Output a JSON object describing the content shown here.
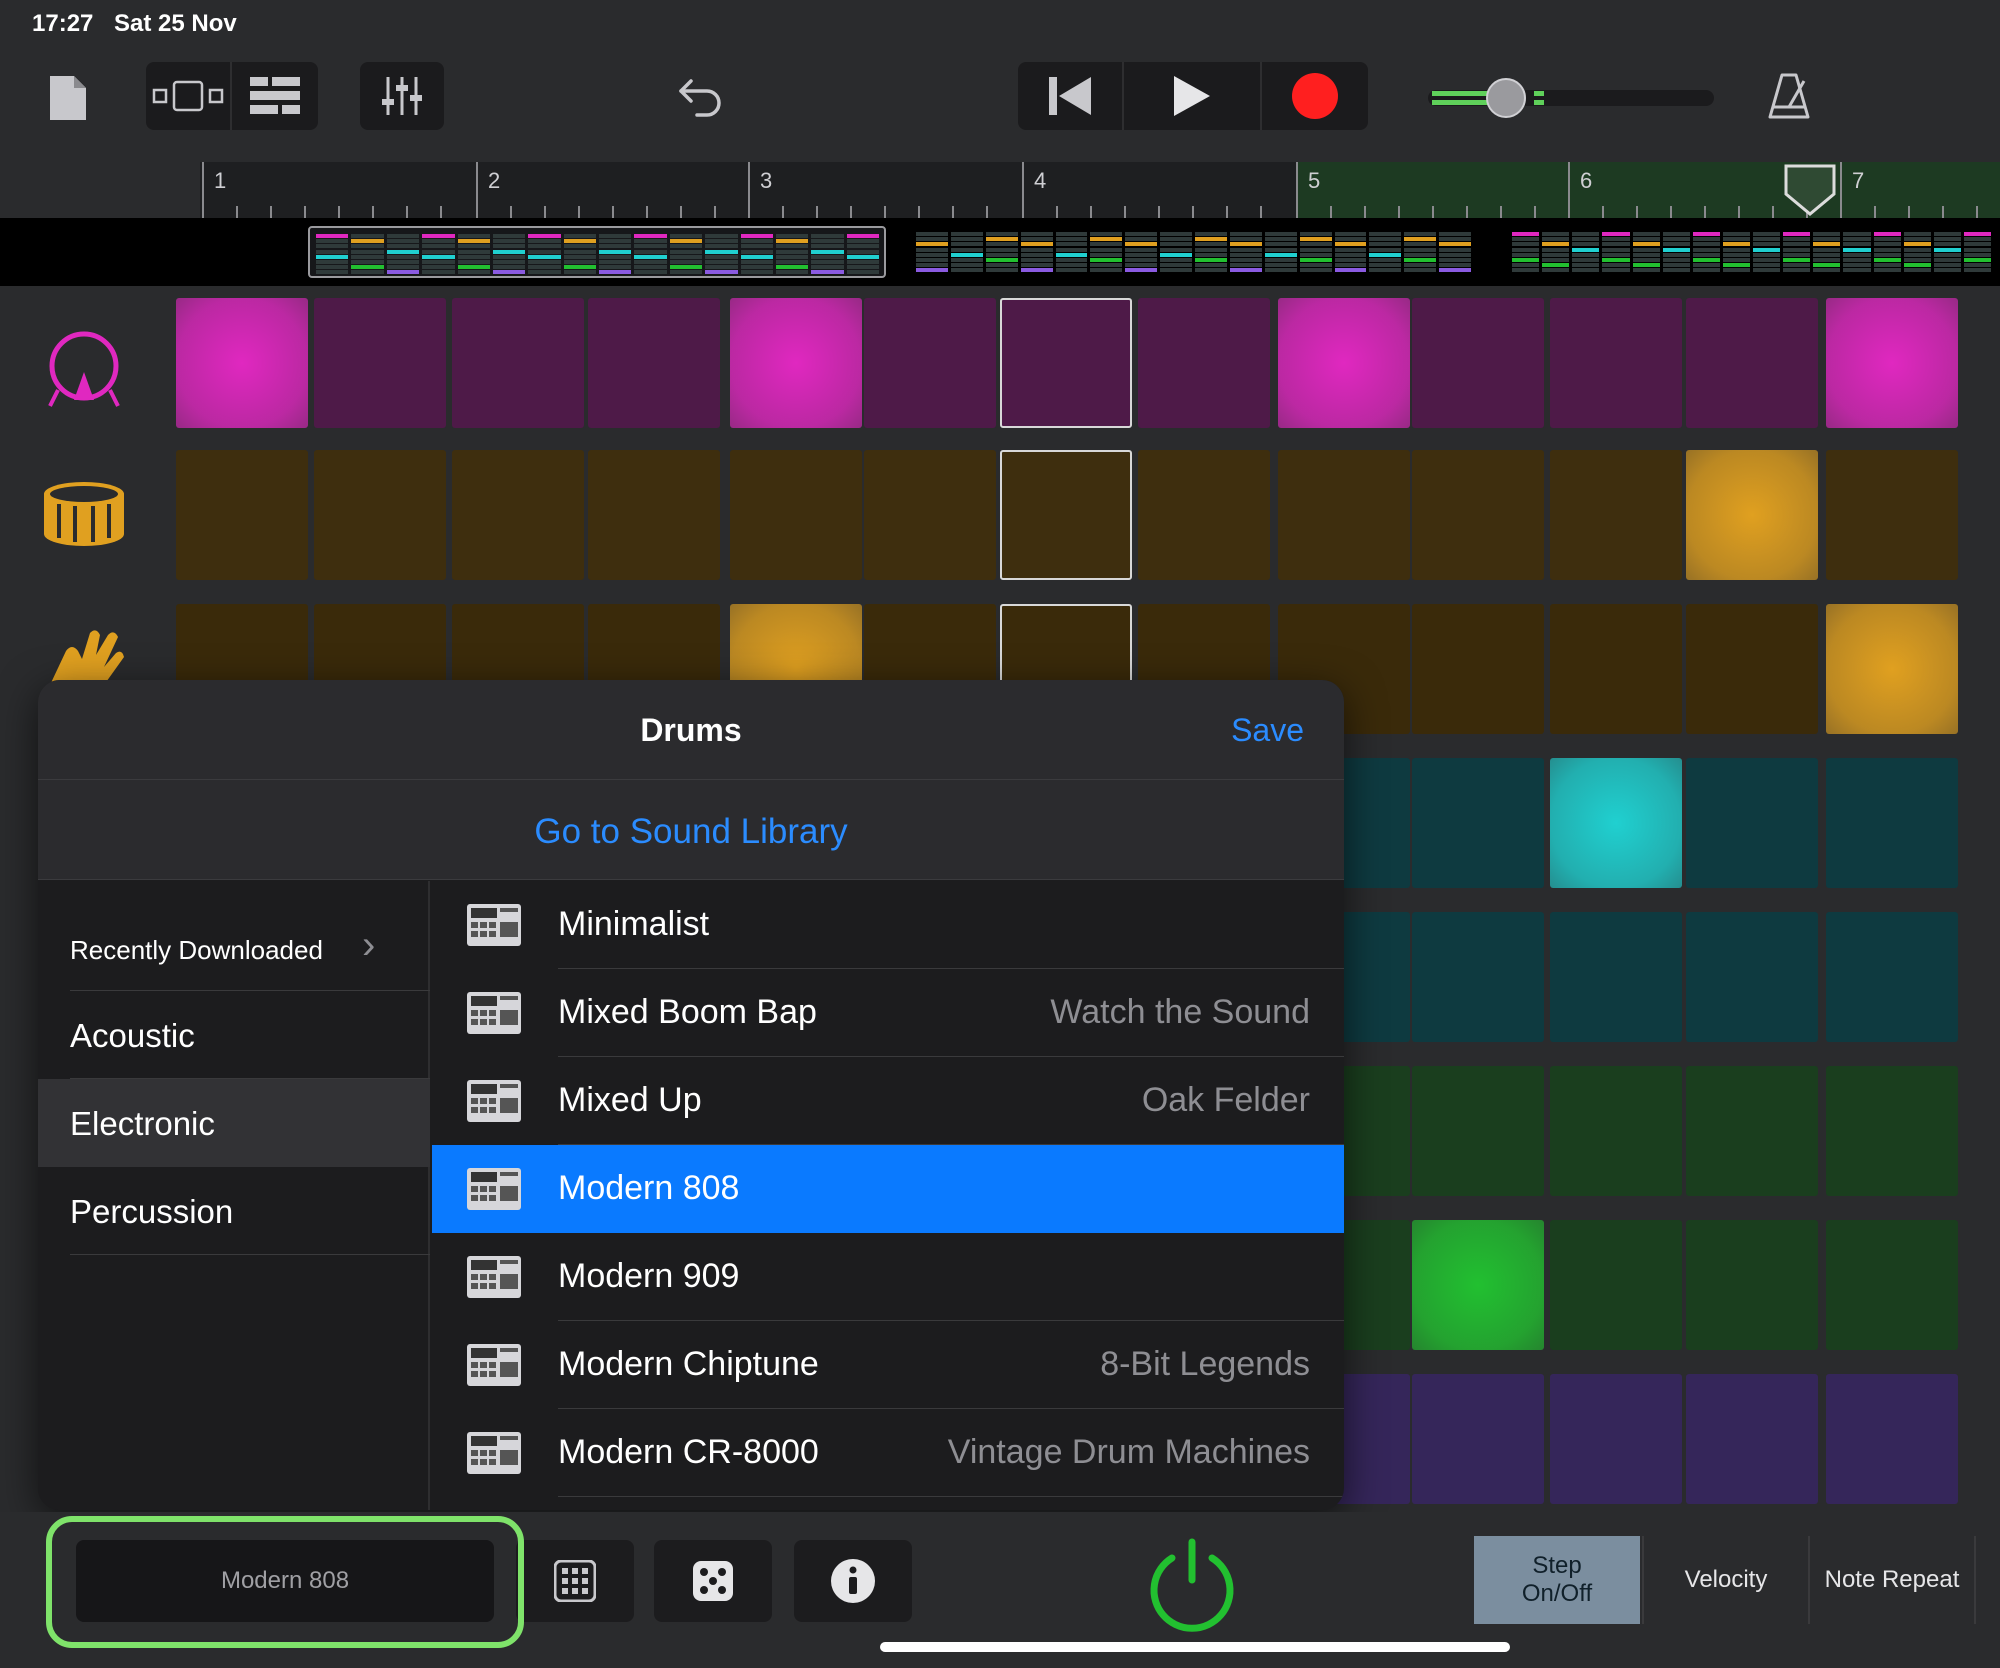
{
  "status": {
    "time": "17:27",
    "date": "Sat 25 Nov"
  },
  "toolbar": {
    "icons": [
      "document-icon",
      "view-switch-icon",
      "tracks-icon",
      "mixer-icon",
      "undo-icon",
      "rewind-icon",
      "play-icon",
      "record-icon",
      "volume-slider",
      "metronome-icon"
    ],
    "record_color": "#ff1f1f",
    "volume_level": 0.28
  },
  "ruler": {
    "bars": [
      "1",
      "2",
      "3",
      "4",
      "5",
      "6",
      "7"
    ]
  },
  "rows": [
    {
      "icon": "kick-drum-icon",
      "color": "#e028c0"
    },
    {
      "icon": "snare-drum-icon",
      "color": "#e0a020"
    },
    {
      "icon": "clap-hand-icon",
      "color": "#e0a020"
    },
    {
      "icon": "",
      "color": "#20d0d0"
    },
    {
      "icon": "",
      "color": "#20d0d0"
    },
    {
      "icon": "",
      "color": "#22c030"
    },
    {
      "icon": "",
      "color": "#22c030"
    },
    {
      "icon": "",
      "color": "#6a40b0"
    }
  ],
  "popover": {
    "title": "Drums",
    "save": "Save",
    "library_link": "Go to Sound Library",
    "categories": [
      {
        "label": "Recently Downloaded",
        "chevron": "›"
      },
      {
        "label": "Acoustic"
      },
      {
        "label": "Electronic",
        "selected": true
      },
      {
        "label": "Percussion"
      }
    ],
    "kits": [
      {
        "name": "Minimalist",
        "pack": ""
      },
      {
        "name": "Mixed Boom Bap",
        "pack": "Watch the Sound"
      },
      {
        "name": "Mixed Up",
        "pack": "Oak Felder"
      },
      {
        "name": "Modern 808",
        "pack": "",
        "selected": true
      },
      {
        "name": "Modern 909",
        "pack": ""
      },
      {
        "name": "Modern Chiptune",
        "pack": "8-Bit Legends"
      },
      {
        "name": "Modern CR-8000",
        "pack": "Vintage Drum Machines"
      }
    ]
  },
  "bottom": {
    "kit_name": "Modern 808",
    "modes": [
      {
        "label": "Step On/Off",
        "selected": true
      },
      {
        "label": "Velocity"
      },
      {
        "label": "Note Repeat"
      }
    ],
    "power_color": "#22c030"
  }
}
